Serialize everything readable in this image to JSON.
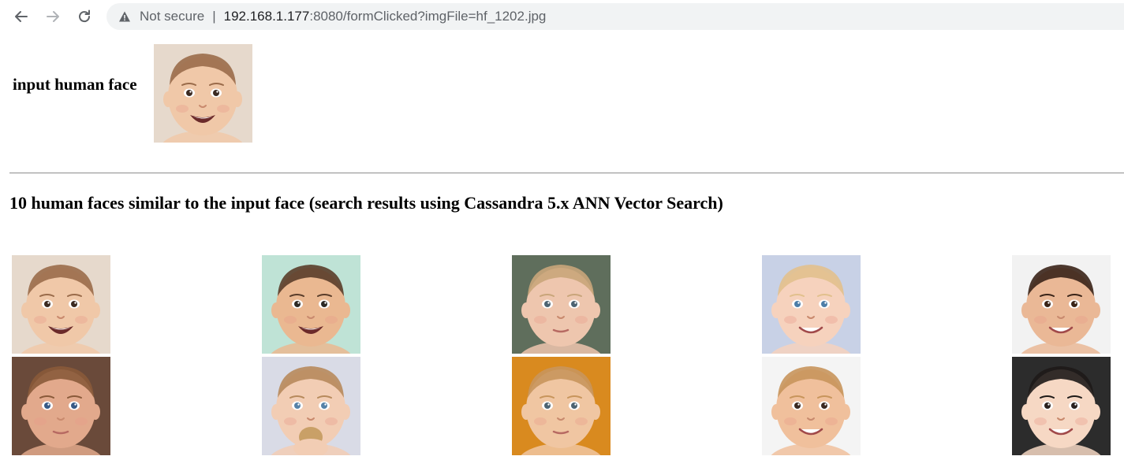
{
  "browser": {
    "security_label": "Not secure",
    "separator": "|",
    "url_host": "192.168.1.177",
    "url_rest": ":8080/formClicked?imgFile=hf_1202.jpg",
    "icons": {
      "back": "back-arrow-icon",
      "forward": "forward-arrow-icon",
      "reload": "reload-icon",
      "warning": "warning-triangle-icon"
    }
  },
  "page": {
    "input_label": "input human face",
    "results_heading": "10 human faces similar to the input face (search results using Cassandra 5.x ANN Vector Search)",
    "input_image": {
      "bg": "#e6d9cc",
      "skin": "#f0c8a8",
      "hair": "#9a6b4a",
      "eye": "#3b2a22",
      "mouth": "open"
    },
    "results": [
      {
        "bg": "#e6d9cc",
        "skin": "#f0c8a8",
        "hair": "#9a6b4a",
        "eye": "#3b2a22",
        "mouth": "open"
      },
      {
        "bg": "#bfe3d6",
        "skin": "#eab891",
        "hair": "#5a3d2a",
        "eye": "#2d2a26",
        "mouth": "open"
      },
      {
        "bg": "#5f6e5c",
        "skin": "#eec6ae",
        "hair": "#c9a57a",
        "eye": "#4d6473",
        "mouth": "flat"
      },
      {
        "bg": "#c8d1e6",
        "skin": "#f6d2bd",
        "hair": "#e2c08d",
        "eye": "#4d7ea8",
        "mouth": "smile"
      },
      {
        "bg": "#f2f2f2",
        "skin": "#eab896",
        "hair": "#3a2418",
        "eye": "#3a2418",
        "mouth": "smile"
      },
      {
        "bg": "#6a4a3a",
        "skin": "#e2a98c",
        "hair": "#8a5a3a",
        "eye": "#375a86",
        "mouth": "flat"
      },
      {
        "bg": "#d9dbe6",
        "skin": "#f2cdb4",
        "hair": "#b78a5c",
        "eye": "#5682a8",
        "mouth": "hand"
      },
      {
        "bg": "#d98a1f",
        "skin": "#f0c6a2",
        "hair": "#c8955c",
        "eye": "#4d6473",
        "mouth": "flat"
      },
      {
        "bg": "#f4f4f4",
        "skin": "#f0c09c",
        "hair": "#c8955c",
        "eye": "#3b2a22",
        "mouth": "smile"
      },
      {
        "bg": "#2c2c2c",
        "skin": "#f6d8c4",
        "hair": "#1e1a18",
        "eye": "#2b2320",
        "mouth": "smile"
      }
    ]
  }
}
